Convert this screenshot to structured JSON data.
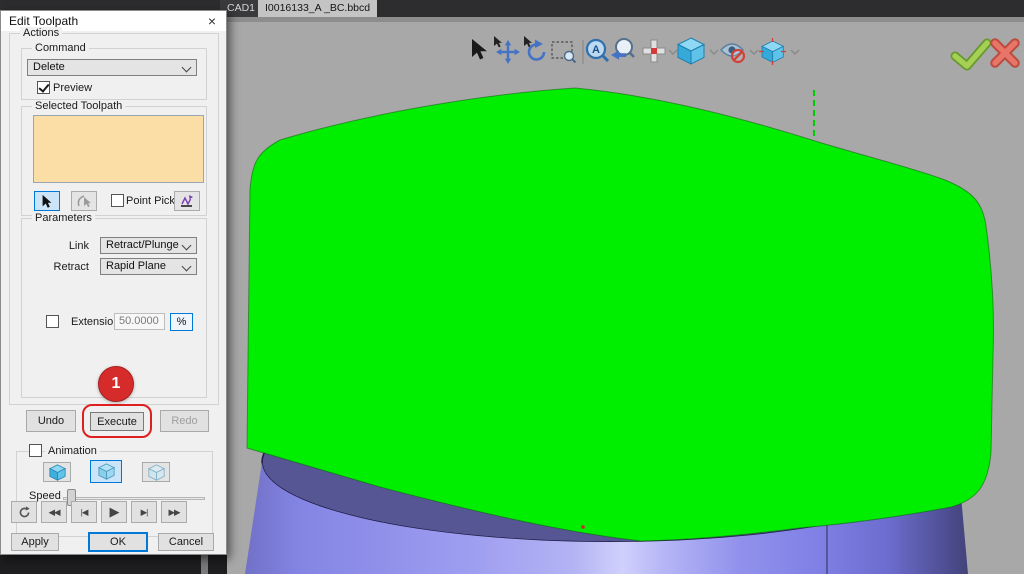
{
  "tab_bar": {
    "inactive_tab_label": "CAD1",
    "active_tab_label": "I0016133_A _BC.bbcd"
  },
  "dialog": {
    "title": "Edit Toolpath",
    "close_glyph": "×",
    "actions_group_label": "Actions",
    "command_group_label": "Command",
    "command_value": "Delete",
    "preview_label": "Preview",
    "preview_checked": true,
    "selected_toolpath_group_label": "Selected Toolpath",
    "point_pick_label": "Point Pick",
    "point_pick_checked": false,
    "parameters_group_label": "Parameters",
    "link_label": "Link",
    "link_value": "Retract/Plunge",
    "retract_label": "Retract",
    "retract_value": "Rapid Plane",
    "extension_label": "Extension",
    "extension_checked": false,
    "extension_value": "50.0000",
    "percent_button_label": "%",
    "step_badge": "1",
    "undo_label": "Undo",
    "execute_label": "Execute",
    "redo_label": "Redo",
    "animation_label": "Animation",
    "animation_checked": false,
    "speed_label": "Speed",
    "playback_glyphs": [
      "◀◀",
      "|◀",
      "▶",
      "▶|",
      "▶▶"
    ],
    "apply_label": "Apply",
    "ok_label": "OK",
    "cancel_label": "Cancel"
  },
  "viewport": {
    "zoom_fit_letter": "A",
    "toolbar_icons": [
      "select-cursor",
      "pan",
      "rotate-view",
      "zoom-window",
      "zoom-fit",
      "zoom-previous",
      "origin-axes",
      "isometric-cube",
      "hide-blank",
      "view-orientation-cube",
      "accept-check",
      "reject-x"
    ],
    "colors": {
      "background": "#a8a8a8",
      "toolpath_highlight": "#00ee00",
      "cylinder_top": "#565694",
      "cylinder_side": "#9a9af0",
      "accent_blue": "#0078d7",
      "annotation_red": "#d62b2b"
    }
  }
}
